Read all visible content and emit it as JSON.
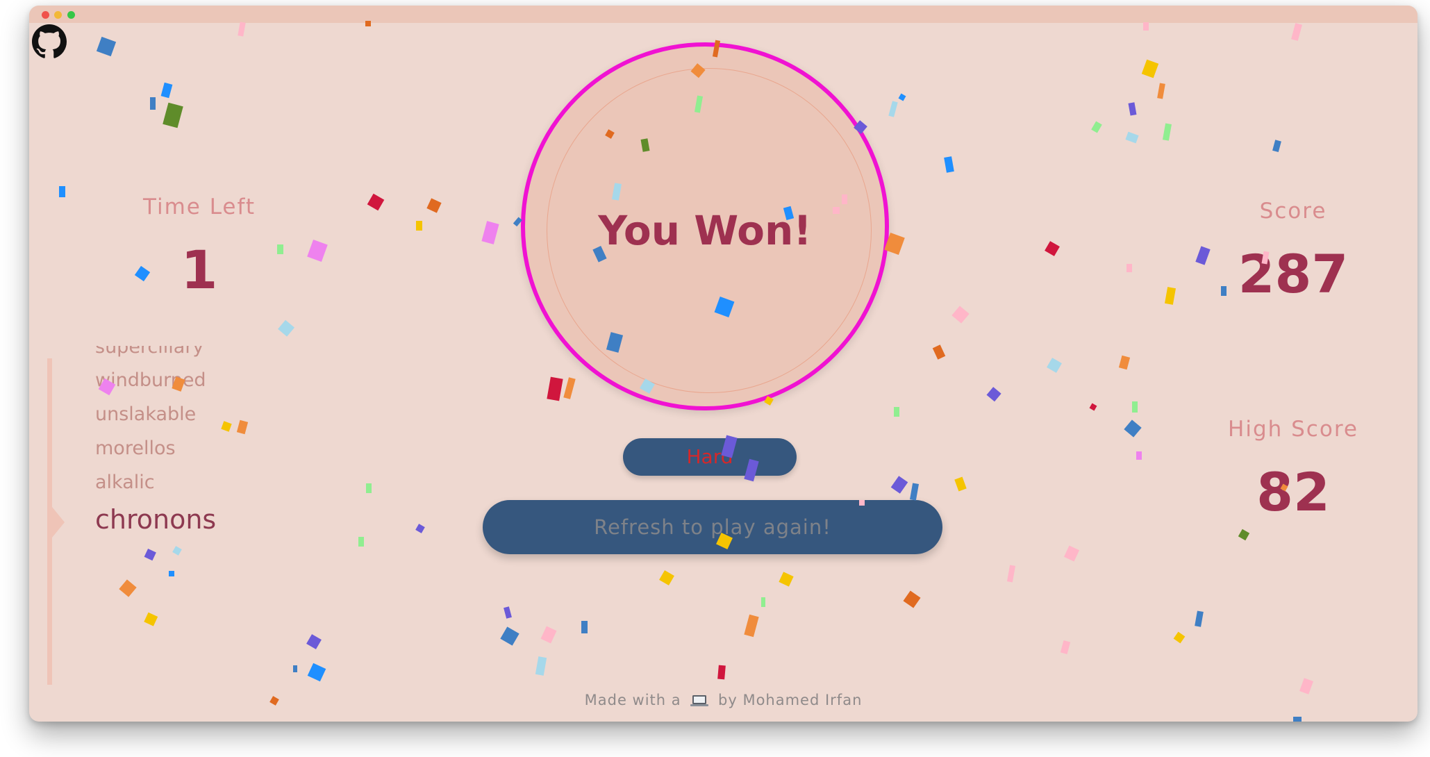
{
  "game": {
    "time_left_label": "Time Left",
    "time_left_value": "1",
    "score_label": "Score",
    "score_value": "287",
    "high_score_label": "High Score",
    "high_score_value": "82",
    "result_text": "You Won!",
    "difficulty": "Hard",
    "refresh_label": "Refresh to play again!"
  },
  "word_list": {
    "items": [
      "superciliary",
      "windburned",
      "unslakable",
      "morellos",
      "alkalic"
    ],
    "current": "chronons"
  },
  "footer": {
    "prefix": "Made with a",
    "icon": "laptop-icon",
    "suffix": "by Mohamed Irfan"
  },
  "colors": {
    "background": "#eed8d0",
    "accent": "#9e3150",
    "ring": "#f012d2",
    "button": "#36577e",
    "difficulty_text": "#d4282a"
  }
}
